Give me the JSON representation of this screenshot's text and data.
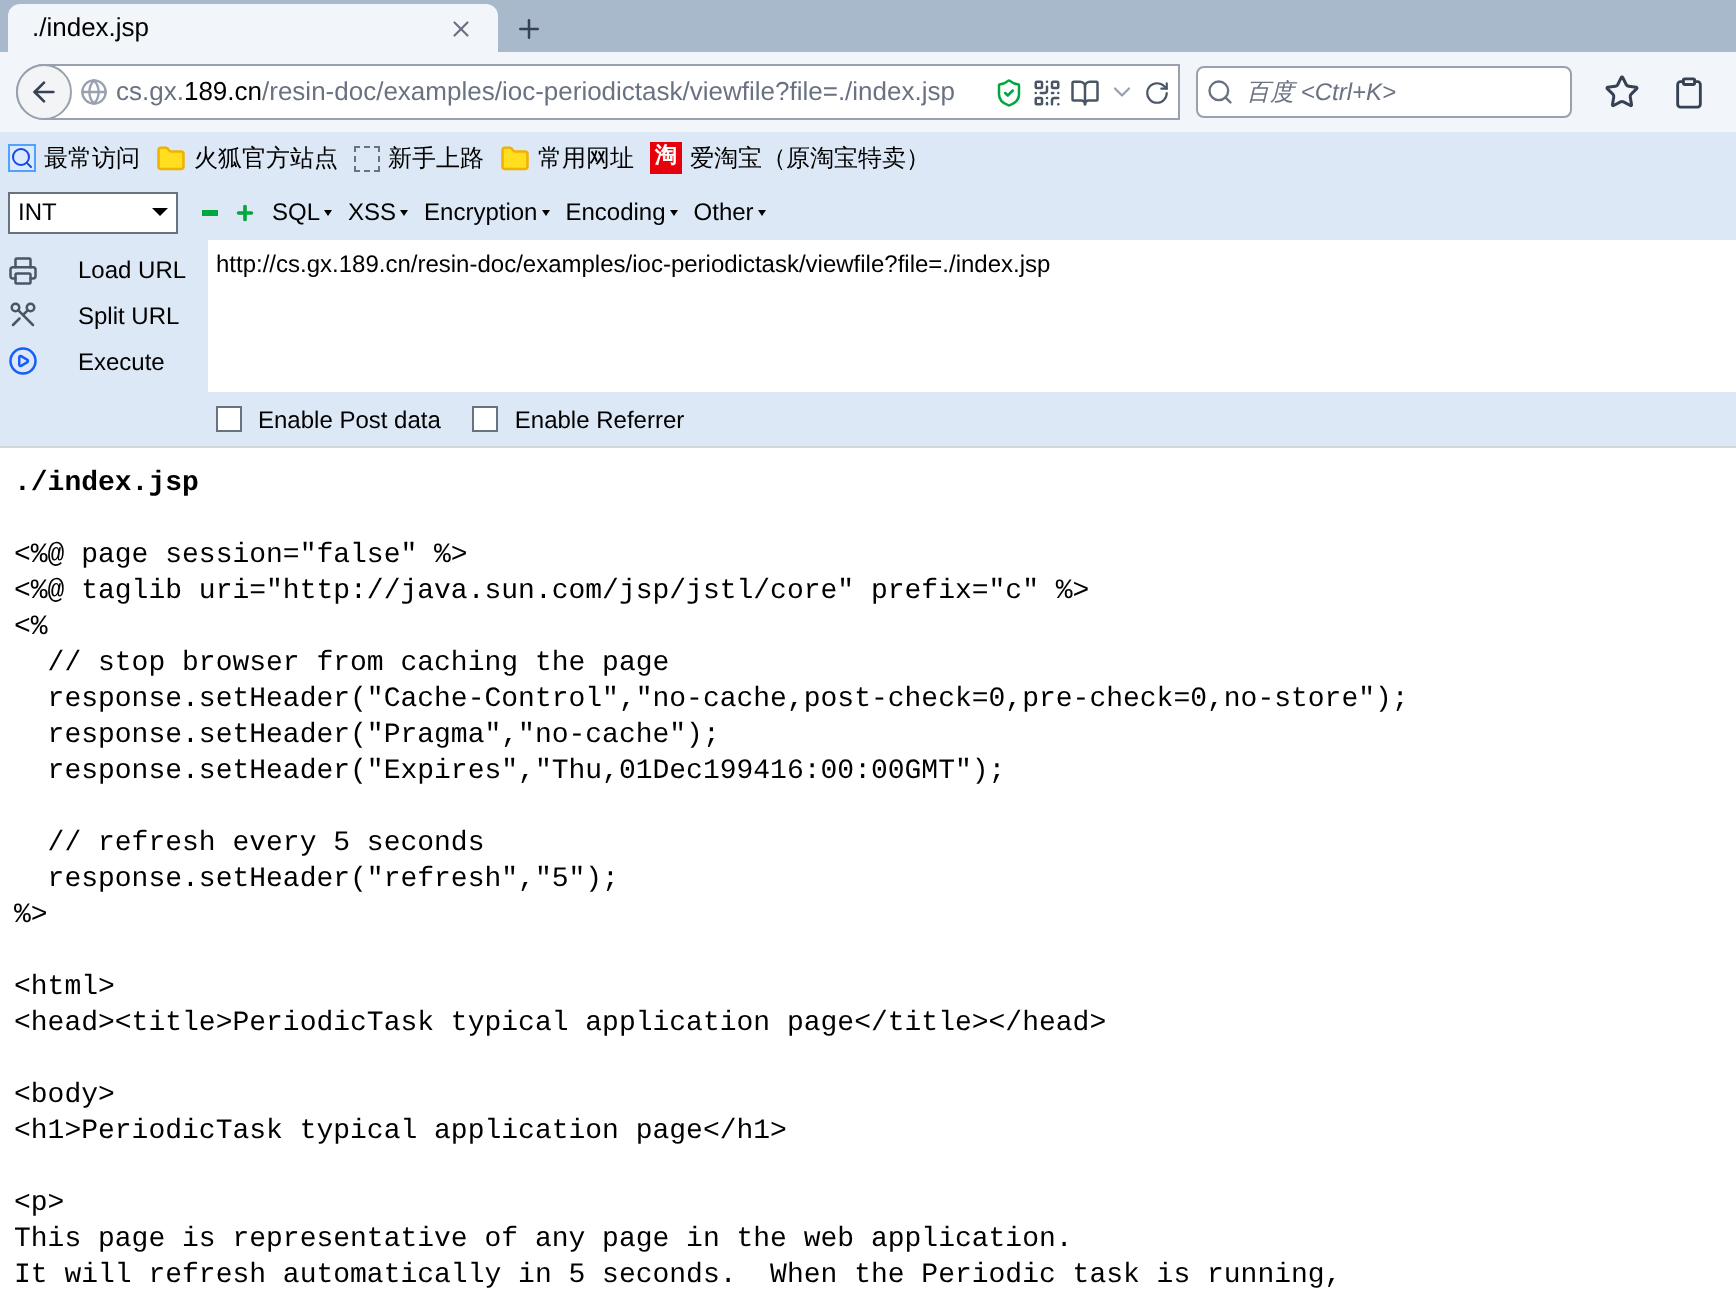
{
  "tabs": [
    {
      "label": "./index.jsp",
      "selected": true
    }
  ],
  "address": {
    "host": "cs.gx.",
    "domain": "189.cn",
    "path": "/resin-doc/examples/ioc-periodictask/viewfile?file=./index.jsp"
  },
  "search": {
    "placeholder": "百度 <Ctrl+K>"
  },
  "bookmarks": [
    {
      "label": "最常访问",
      "kind": "page"
    },
    {
      "label": "火狐官方站点",
      "kind": "folder"
    },
    {
      "label": "新手上路",
      "kind": "dashed"
    },
    {
      "label": "常用网址",
      "kind": "folder"
    },
    {
      "label": "爱淘宝（原淘宝特卖）",
      "kind": "badge",
      "badge": "淘"
    }
  ],
  "hackbar": {
    "select": "INT",
    "menus": [
      "SQL",
      "XSS",
      "Encryption",
      "Encoding",
      "Other"
    ],
    "actions": [
      {
        "label": "Load URL",
        "kind": "load"
      },
      {
        "label": "Split URL",
        "kind": "split"
      },
      {
        "label": "Execute",
        "kind": "execute"
      }
    ],
    "url": "http://cs.gx.189.cn/resin-doc/examples/ioc-periodictask/viewfile?file=./index.jsp",
    "options": [
      {
        "label": "Enable Post data",
        "checked": false
      },
      {
        "label": "Enable Referrer",
        "checked": false
      }
    ]
  },
  "content": {
    "title": "./index.jsp",
    "code_blocks": [
      [
        "<%@ page session=\"false\" %>",
        "<%@ taglib uri=\"http://java.sun.com/jsp/jstl/core\" prefix=\"c\" %>",
        "<%",
        "  // stop browser from caching the page",
        "  response.setHeader(\"Cache-Control\",\"no-cache,post-check=0,pre-check=0,no-store\");",
        "  response.setHeader(\"Pragma\",\"no-cache\");",
        "  response.setHeader(\"Expires\",\"Thu,01Dec199416:00:00GMT\");"
      ],
      [
        "  // refresh every 5 seconds",
        "  response.setHeader(\"refresh\",\"5\");",
        "%>"
      ],
      [
        "<html>",
        "<head><title>PeriodicTask typical application page</title></head>"
      ],
      [
        "<body>",
        "<h1>PeriodicTask typical application page</h1>"
      ],
      [
        "<p>",
        "This page is representative of any page in the web application.",
        "It will refresh automatically in 5 seconds.  When the Periodic task is running,"
      ]
    ]
  }
}
